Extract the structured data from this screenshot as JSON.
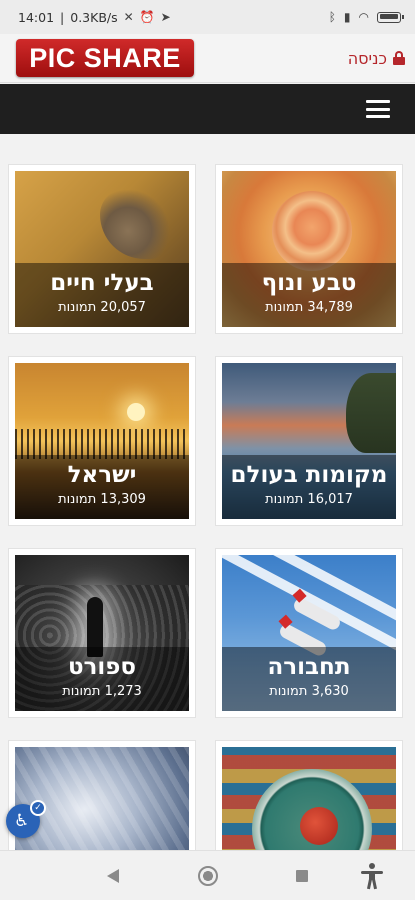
{
  "status_bar": {
    "time": "14:01",
    "network_speed": "0.3KB/s",
    "icons": [
      "vibrate-off-icon",
      "alarm-icon",
      "telegram-icon",
      "bluetooth-icon",
      "signal-icon",
      "wifi-icon",
      "battery-icon"
    ],
    "battery_level": 0.8
  },
  "header": {
    "logo_text": "PIC SHARE",
    "login_label": "כניסה",
    "login_icon": "lock-icon",
    "accent_color": "#b5262b"
  },
  "navbar": {
    "menu_icon": "hamburger-menu-icon"
  },
  "categories": [
    {
      "title": "טבע ונוף",
      "count": "34,789 תמונות"
    },
    {
      "title": "בעלי חיים",
      "count": "20,057 תמונות"
    },
    {
      "title": "מקומות בעולם",
      "count": "16,017 תמונות"
    },
    {
      "title": "ישראל",
      "count": "13,309 תמונות"
    },
    {
      "title": "תחבורה",
      "count": "3,630 תמונות"
    },
    {
      "title": "ספורט",
      "count": "1,273 תמונות"
    }
  ],
  "system_nav": {
    "icons": [
      "back-icon",
      "home-icon",
      "recents-icon",
      "accessibility-icon"
    ]
  },
  "accessibility_widget": {
    "icon": "wheelchair-icon"
  }
}
